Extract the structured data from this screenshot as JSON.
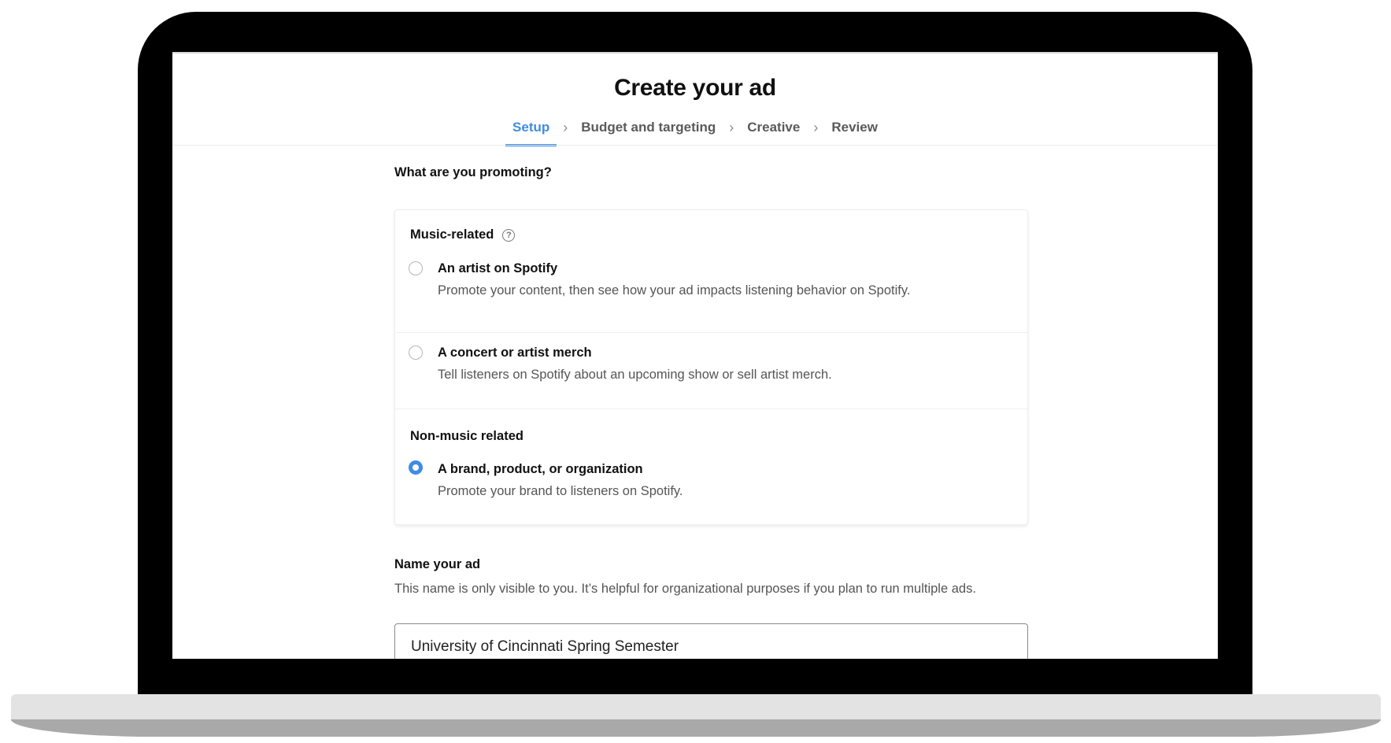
{
  "page": {
    "title": "Create your ad"
  },
  "stepper": {
    "steps": [
      {
        "label": "Setup",
        "active": true
      },
      {
        "label": "Budget and targeting",
        "active": false
      },
      {
        "label": "Creative",
        "active": false
      },
      {
        "label": "Review",
        "active": false
      }
    ],
    "separator_icon": "chevron-right-icon",
    "separator_glyph": "›"
  },
  "promoting": {
    "label": "What are you promoting?",
    "music_group": {
      "heading": "Music-related",
      "help_icon": "question-circle-icon",
      "help_glyph": "?"
    },
    "options": [
      {
        "title": "An artist on Spotify",
        "description": "Promote your content, then see how your ad impacts listening behavior on Spotify.",
        "selected": false
      },
      {
        "title": "A concert or artist merch",
        "description": "Tell listeners on Spotify about an upcoming show or sell artist merch.",
        "selected": false
      },
      {
        "title": "A brand, product, or organization",
        "description": "Promote your brand to listeners on Spotify.",
        "selected": true
      }
    ],
    "non_music_group": {
      "heading": "Non-music related"
    }
  },
  "ad_name": {
    "label": "Name your ad",
    "help": "This name is only visible to you. It’s helpful for organizational purposes if you plan to run multiple ads.",
    "value": "University of Cincinnati Spring Semester"
  },
  "colors": {
    "accent": "#3f8ce3",
    "device_frame": "#000000",
    "text_primary": "#111111",
    "text_secondary": "#555555"
  }
}
